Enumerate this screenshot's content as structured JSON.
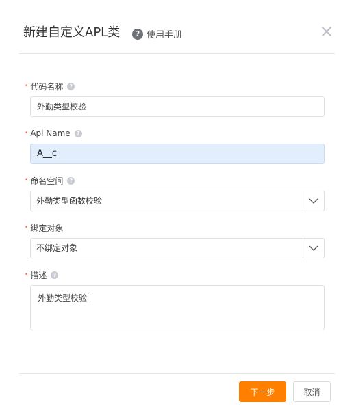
{
  "dialog": {
    "title": "新建自定义APL类",
    "manual_label": "使用手册",
    "help_glyph": "?"
  },
  "fields": {
    "code_name": {
      "label": "代码名称",
      "value": "外勤类型校验",
      "required": true
    },
    "api_name": {
      "label": "Api Name",
      "value": "A__c",
      "required": true
    },
    "namespace": {
      "label": "命名空间",
      "value": "外勤类型函数校验",
      "required": true
    },
    "bind_object": {
      "label": "绑定对象",
      "value": "不绑定对象",
      "required": true
    },
    "description": {
      "label": "描述",
      "value": "外勤类型校验",
      "required": true
    }
  },
  "required_mark": "•",
  "buttons": {
    "next": "下一步",
    "cancel": "取消"
  },
  "colors": {
    "primary": "#ff8000",
    "required": "#ff6d3f",
    "locked_input_bg": "#e2eefb"
  }
}
